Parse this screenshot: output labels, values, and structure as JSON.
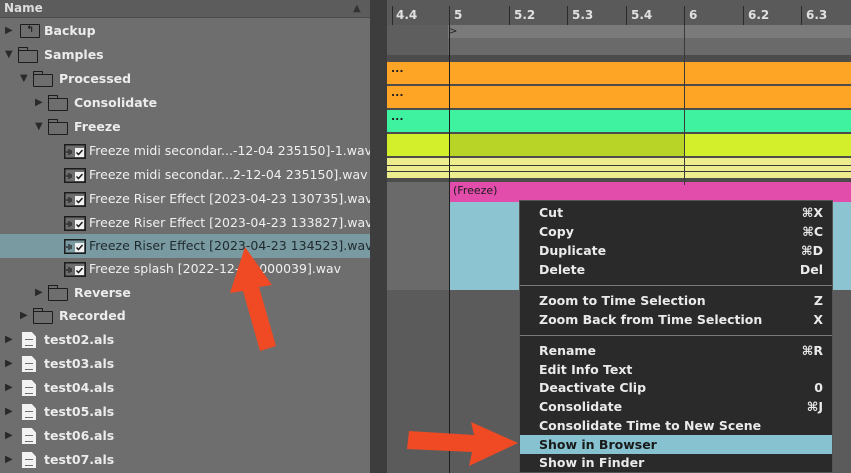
{
  "browser": {
    "header_label": "Name",
    "sort_glyph": "▲",
    "items": [
      {
        "label": "Backup",
        "kind": "backup",
        "arrow": "▶"
      },
      {
        "label": "Samples",
        "kind": "folder",
        "arrow": "▼"
      },
      {
        "label": "Processed",
        "kind": "folder",
        "arrow": "▼"
      },
      {
        "label": "Consolidate",
        "kind": "folder",
        "arrow": "▶"
      },
      {
        "label": "Freeze",
        "kind": "folder",
        "arrow": "▼"
      },
      {
        "label": "Freeze midi secondar...-12-04 235150]-1.wav",
        "kind": "wav",
        "arrow": ""
      },
      {
        "label": "Freeze midi secondar...2-12-04 235150].wav",
        "kind": "wav",
        "arrow": ""
      },
      {
        "label": "Freeze Riser Effect [2023-04-23 130735].wav",
        "kind": "wav",
        "arrow": ""
      },
      {
        "label": "Freeze Riser Effect [2023-04-23 133827].wav",
        "kind": "wav",
        "arrow": ""
      },
      {
        "label": "Freeze Riser Effect [2023-04-23 134523].wav",
        "kind": "wav",
        "arrow": "",
        "selected": true
      },
      {
        "label": "Freeze splash [2022-12-05 000039].wav",
        "kind": "wav",
        "arrow": ""
      },
      {
        "label": "Reverse",
        "kind": "folder",
        "arrow": "▶"
      },
      {
        "label": "Recorded",
        "kind": "folder",
        "arrow": "▶"
      },
      {
        "label": "test02.als",
        "kind": "doc",
        "arrow": "▶"
      },
      {
        "label": "test03.als",
        "kind": "doc",
        "arrow": "▶"
      },
      {
        "label": "test04.als",
        "kind": "doc",
        "arrow": "▶"
      },
      {
        "label": "test05.als",
        "kind": "doc",
        "arrow": "▶"
      },
      {
        "label": "test06.als",
        "kind": "doc",
        "arrow": "▶"
      },
      {
        "label": "test07.als",
        "kind": "doc",
        "arrow": "▶"
      }
    ]
  },
  "ruler": {
    "labels": [
      "4.4",
      "5",
      "5.2",
      "5.3",
      "5.4",
      "6",
      "6.2",
      "6.3"
    ]
  },
  "clips": {
    "labels": [
      "...",
      "...",
      "...",
      "(Freeze)"
    ],
    "colors": {
      "orange": "#ffa526",
      "green": "#3ef2a0",
      "yellow_green": "#d3ef2b",
      "pale_yellow": "#eded8e",
      "pink": "#e24cab",
      "light_blue": "#8dc4d2"
    }
  },
  "context_menu": {
    "groups": [
      [
        {
          "label": "Cut",
          "shortcut": "⌘X"
        },
        {
          "label": "Copy",
          "shortcut": "⌘C"
        },
        {
          "label": "Duplicate",
          "shortcut": "⌘D"
        },
        {
          "label": "Delete",
          "shortcut": "Del"
        }
      ],
      [
        {
          "label": "Zoom to Time Selection",
          "shortcut": "Z"
        },
        {
          "label": "Zoom Back from Time Selection",
          "shortcut": "X"
        }
      ],
      [
        {
          "label": "Rename",
          "shortcut": "⌘R"
        },
        {
          "label": "Edit Info Text",
          "shortcut": ""
        },
        {
          "label": "Deactivate Clip",
          "shortcut": "0"
        },
        {
          "label": "Consolidate",
          "shortcut": "⌘J"
        },
        {
          "label": "Consolidate Time to New Scene",
          "shortcut": ""
        },
        {
          "label": "Show in Browser",
          "shortcut": "",
          "highlighted": true
        },
        {
          "label": "Show in Finder",
          "shortcut": ""
        }
      ]
    ]
  },
  "colors": {
    "selection": "#7a9aa2",
    "menu_highlight": "#86c2cf",
    "annotation_arrow": "#f04a24"
  }
}
